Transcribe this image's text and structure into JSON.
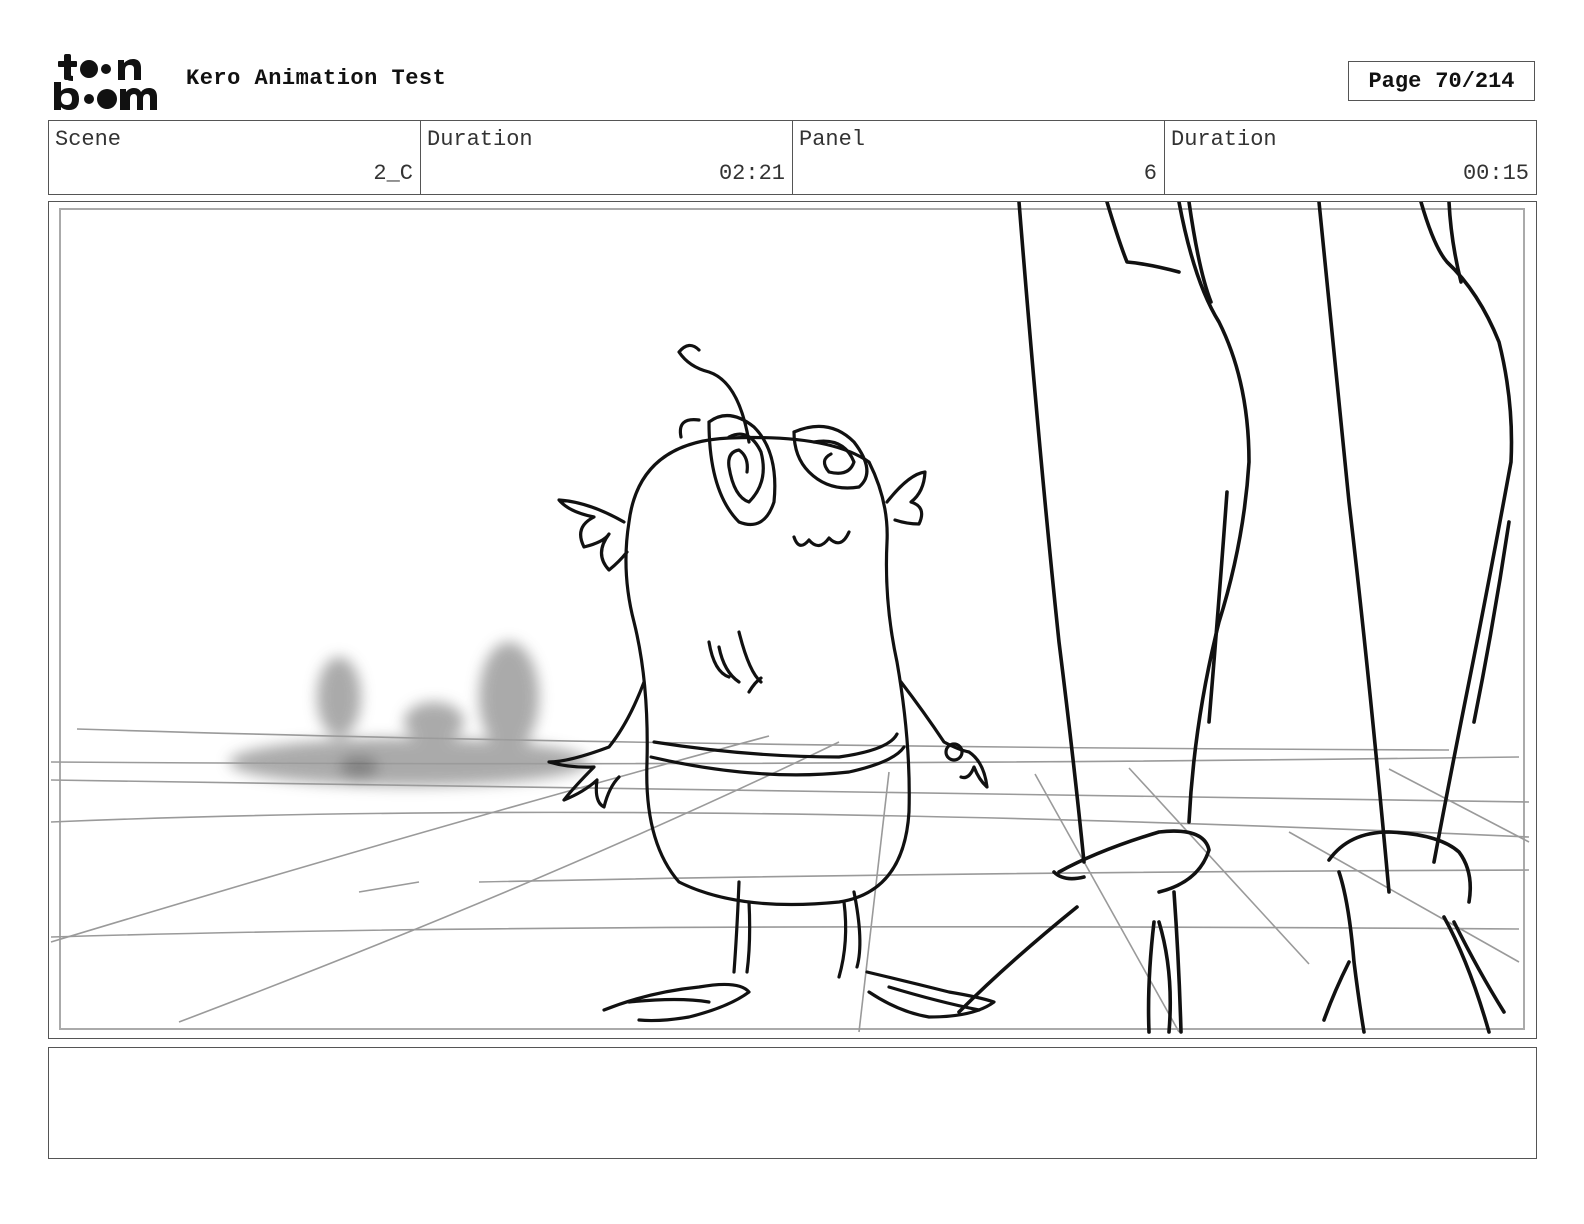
{
  "logo": {
    "line1": "toon",
    "line2": "boom",
    "icon": "toon-boom-logo"
  },
  "project_title": "Kero Animation Test",
  "page": {
    "label": "Page",
    "number": "70/214"
  },
  "info": [
    {
      "label": "Scene",
      "value": "2_C"
    },
    {
      "label": "Duration",
      "value": "02:21"
    },
    {
      "label": "Panel",
      "value": "6"
    },
    {
      "label": "Duration",
      "value": "00:15"
    }
  ],
  "panel_image": {
    "icon": "storyboard-sketch-frog-character-and-legs"
  },
  "notes": ""
}
